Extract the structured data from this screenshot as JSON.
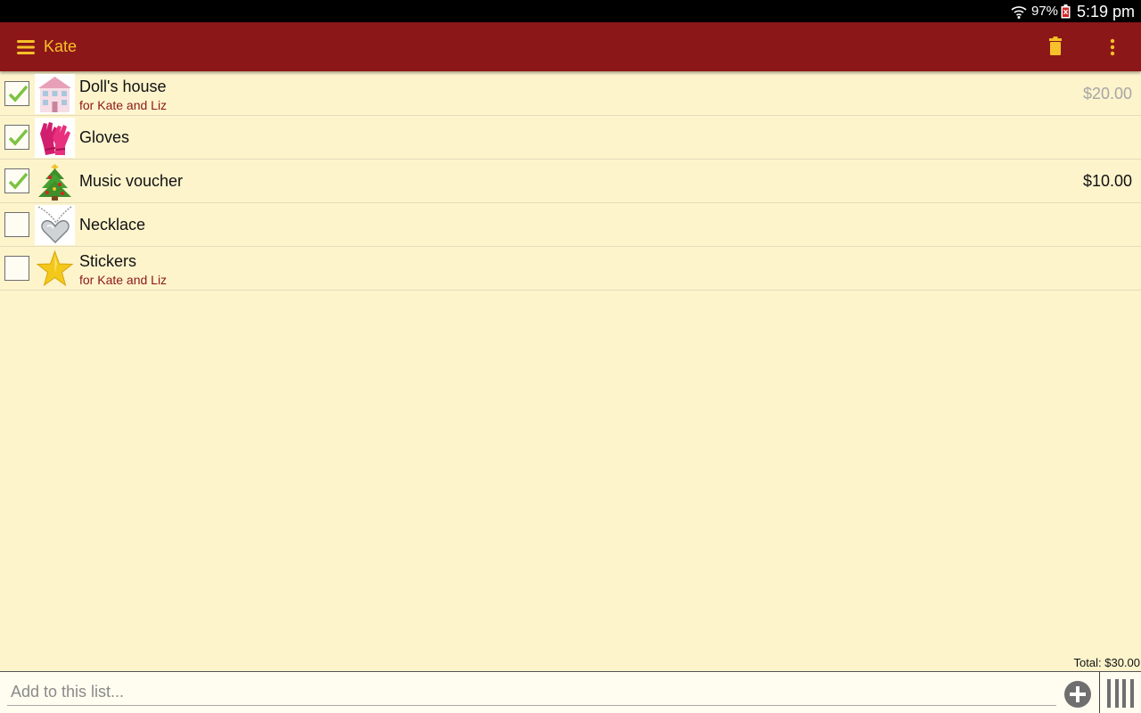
{
  "status_bar": {
    "battery_percent": "97%",
    "time": "5:19 pm"
  },
  "app_bar": {
    "title": "Kate",
    "accent_color": "#f6c12a",
    "bar_color": "#8c1718"
  },
  "items": [
    {
      "name": "Doll's house",
      "subtitle": "for Kate and Liz",
      "price": "$20.00",
      "checked": true,
      "icon": "dolls-house-icon"
    },
    {
      "name": "Gloves",
      "subtitle": "",
      "price": "",
      "checked": true,
      "icon": "gloves-icon"
    },
    {
      "name": "Music voucher",
      "subtitle": "",
      "price": "$10.00",
      "checked": true,
      "icon": "christmas-tree-icon"
    },
    {
      "name": "Necklace",
      "subtitle": "",
      "price": "",
      "checked": false,
      "icon": "heart-necklace-icon"
    },
    {
      "name": "Stickers",
      "subtitle": "for Kate and Liz",
      "price": "",
      "checked": false,
      "icon": "star-icon"
    }
  ],
  "total": "Total: $30.00",
  "add_bar": {
    "placeholder": "Add to this list..."
  }
}
